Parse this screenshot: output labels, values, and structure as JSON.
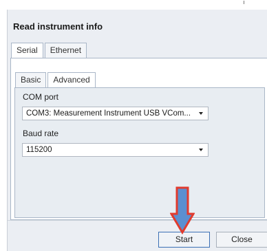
{
  "dialog": {
    "title": "Read instrument info"
  },
  "tabs_outer": [
    {
      "label": "Serial",
      "active": true
    },
    {
      "label": "Ethernet",
      "active": false
    }
  ],
  "tabs_inner": [
    {
      "label": "Basic",
      "active": false
    },
    {
      "label": "Advanced",
      "active": true
    }
  ],
  "fields": {
    "com_port": {
      "label": "COM port",
      "value": "COM3: Measurement Instrument USB VCom..."
    },
    "baud_rate": {
      "label": "Baud rate",
      "value": "115200"
    }
  },
  "buttons": {
    "start": "Start",
    "close": "Close"
  },
  "colors": {
    "arrow_fill": "#5b8fd0",
    "arrow_outline": "#e13b2e",
    "active_border": "#3b6fb4"
  },
  "icons": {
    "dropdown": "chevron-down-icon",
    "annotation": "down-arrow-icon"
  }
}
